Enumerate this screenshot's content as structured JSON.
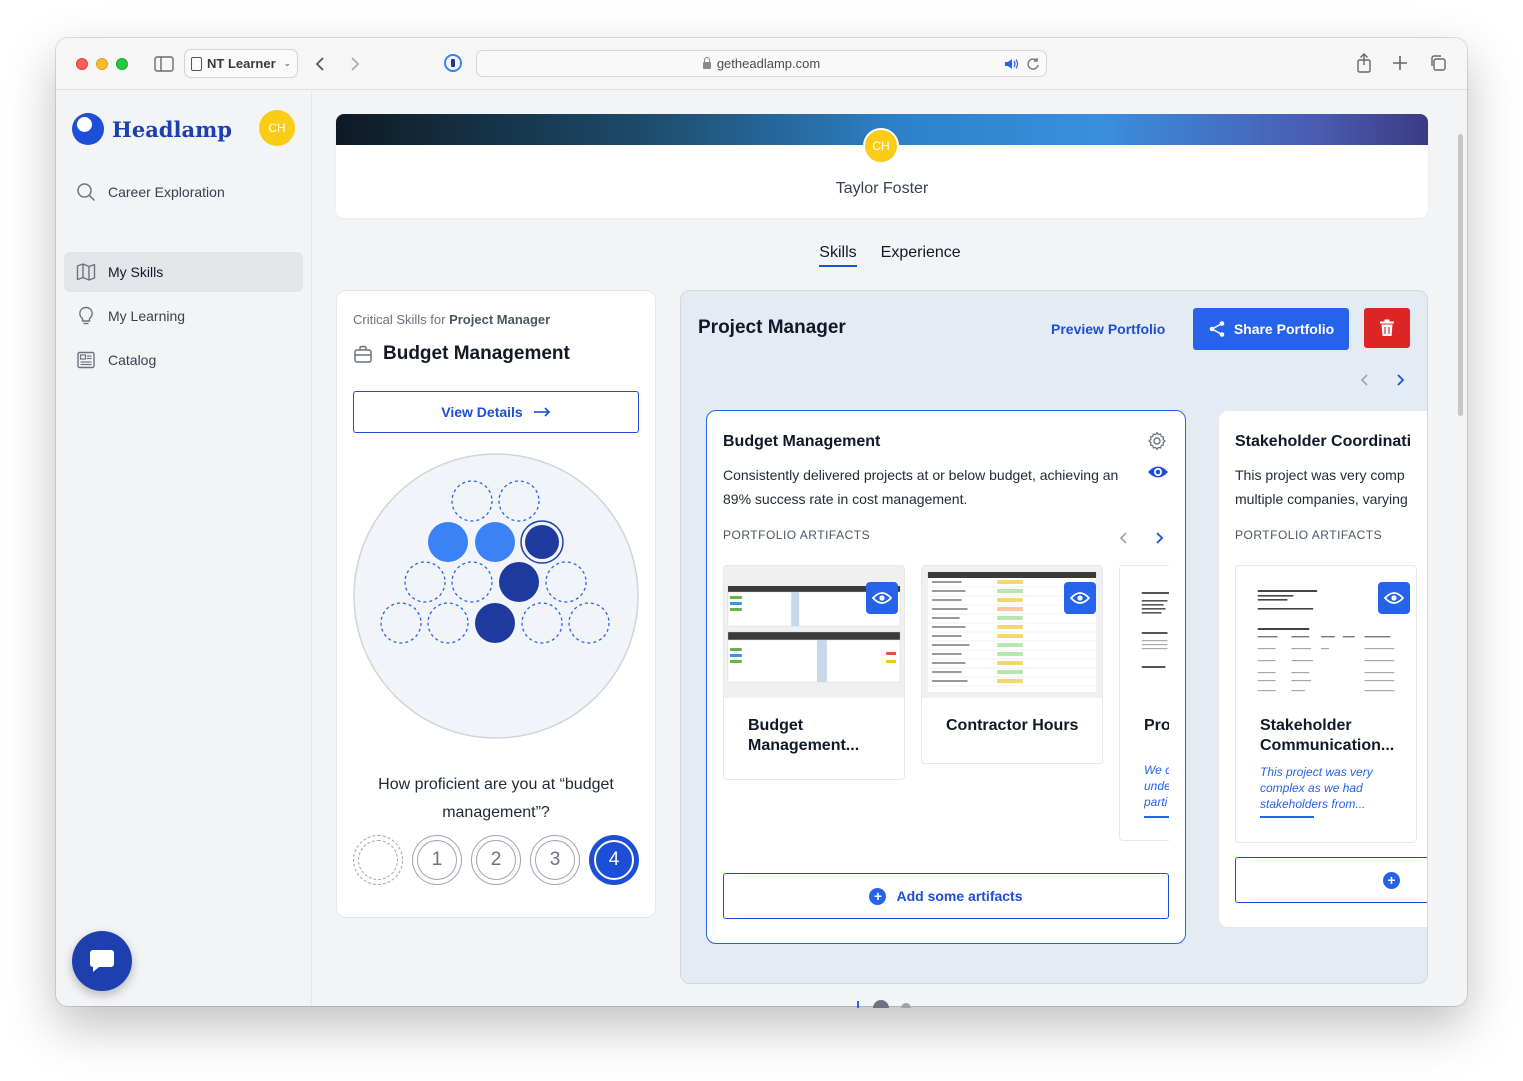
{
  "browser": {
    "profile": "NT Learner",
    "url": "getheadlamp.com"
  },
  "sidebar": {
    "brand": "Headlamp",
    "avatar_initials": "CH",
    "items": [
      {
        "label": "Career Exploration",
        "icon": "search-icon",
        "active": false
      },
      {
        "label": "My Skills",
        "icon": "map-icon",
        "active": true
      },
      {
        "label": "My Learning",
        "icon": "lightbulb-icon",
        "active": false
      },
      {
        "label": "Catalog",
        "icon": "catalog-icon",
        "active": false
      }
    ]
  },
  "profile": {
    "initials": "CH",
    "name": "Taylor Foster"
  },
  "tabs": [
    {
      "label": "Skills",
      "active": true
    },
    {
      "label": "Experience",
      "active": false
    }
  ],
  "skill_card": {
    "prefix": "Critical Skills for ",
    "role": "Project Manager",
    "skill": "Budget Management",
    "view_details": "View Details",
    "question": "How proficient are you at “budget management”?",
    "ratings": [
      "",
      "1",
      "2",
      "3",
      "4"
    ],
    "selected_rating": "4"
  },
  "portfolio": {
    "title": "Project Manager",
    "preview": "Preview Portfolio",
    "share": "Share Portfolio",
    "cards": [
      {
        "title": "Budget Management",
        "description": "Consistently delivered projects at or below budget, achieving an 89% success rate in cost management.",
        "artifacts_label": "PORTFOLIO ARTIFACTS",
        "add_label": "Add some artifacts",
        "artifacts": [
          {
            "title": "Budget Management..."
          },
          {
            "title": "Contractor Hours"
          },
          {
            "title": "Pro Plan",
            "subtitle": "We c unde parti"
          }
        ]
      },
      {
        "title": "Stakeholder Coordinati",
        "description_line1": "This project was very comp",
        "description_line2": "multiple companies, varying",
        "artifacts_label": "PORTFOLIO ARTIFACTS",
        "artifacts": [
          {
            "title": "Stakeholder Communication...",
            "subtitle": "This project was very complex as we had stakeholders from..."
          }
        ]
      }
    ]
  },
  "colors": {
    "brand": "#1d4ed8",
    "accent": "#2563eb",
    "danger": "#dc2626",
    "avatar": "#facc15"
  }
}
